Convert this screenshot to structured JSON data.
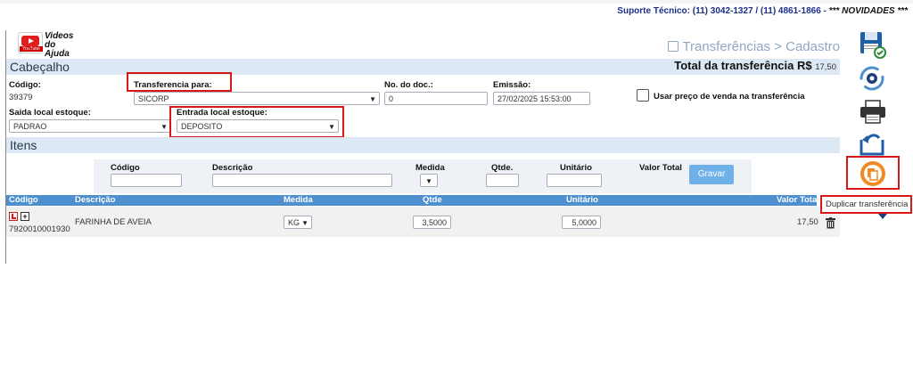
{
  "support": {
    "text": "Suporte Técnico: (11) 3042-1327 / (11) 4861-1866 - ",
    "novidades": "*** NOVIDADES ***"
  },
  "help": {
    "line1": "Videos",
    "line2": "do Ajuda",
    "yt_caption": "YouTube"
  },
  "breadcrumb": "Transferências > Cadastro",
  "header": {
    "section_title": "Cabeçalho",
    "total_label": "Total da transferência R$",
    "total_value": "17,50",
    "codigo_label": "Código:",
    "codigo_value": "39379",
    "transferencia_para_label": "Transferencia para:",
    "transferencia_para_value": "SICORP",
    "no_doc_label": "No. do doc.:",
    "no_doc_value": "0",
    "emissao_label": "Emissão:",
    "emissao_value": "27/02/2025 15:53:00",
    "usar_preco_label": "Usar preço de venda na transferência",
    "saida_label": "Saida local estoque:",
    "saida_value": "PADRAO",
    "entrada_label": "Entrada local estoque:",
    "entrada_value": "DEPOSITO"
  },
  "itens": {
    "section_title": "Itens",
    "filter": {
      "codigo_label": "Código",
      "descricao_label": "Descrição",
      "medida_label": "Medida",
      "qtde_label": "Qtde.",
      "unitario_label": "Unitário",
      "valor_total_label": "Valor Total",
      "gravar_label": "Gravar"
    },
    "columns": [
      "Código",
      "Descrição",
      "Medida",
      "Qtde",
      "Unitário",
      "Valor Total"
    ],
    "rows": [
      {
        "codigo": "7920010001930",
        "descricao": "FARINHA DE AVEIA",
        "medida": "KG",
        "qtde": "3,5000",
        "unitario": "5,0000",
        "valor_total": "17,50"
      }
    ]
  },
  "sidebar": {
    "tooltip": "Duplicar transferência"
  },
  "colors": {
    "accent": "#4e8fd0",
    "highlight": "#d81818",
    "section": "#dce8f4",
    "duplicate": "#f08a24"
  }
}
